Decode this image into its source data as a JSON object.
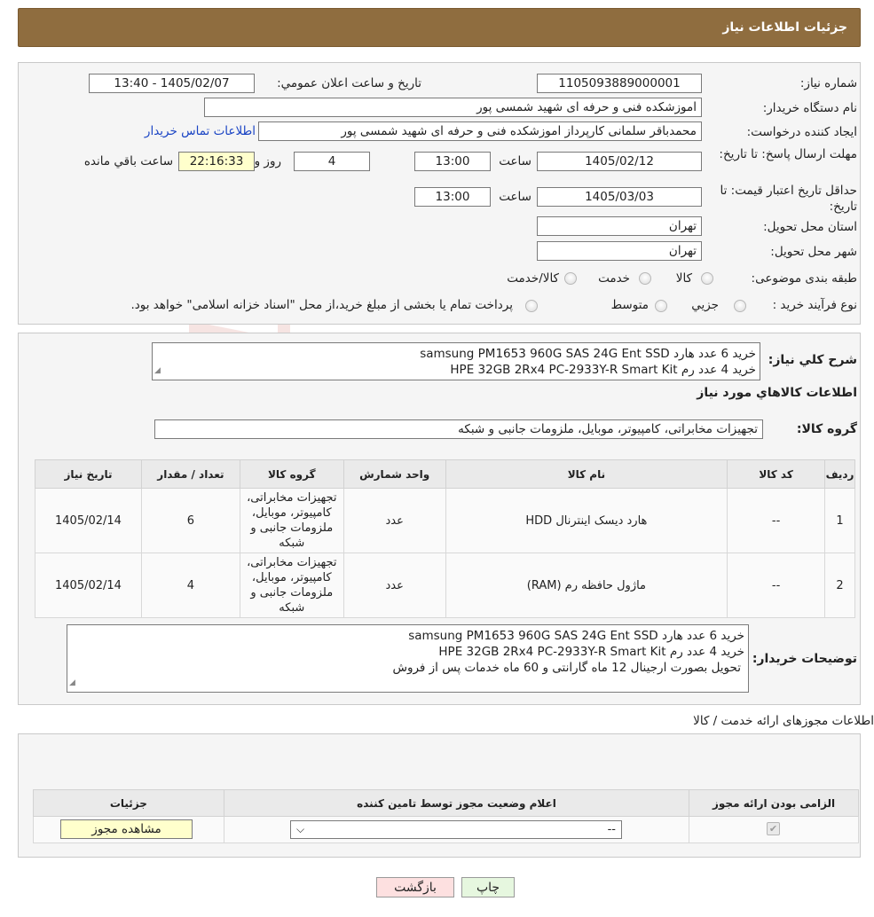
{
  "header": {
    "title": "جزئیات اطلاعات نیاز"
  },
  "fields": {
    "need_number_label": "شماره نیاز:",
    "need_number": "1105093889000001",
    "announce_label": "تاریخ و ساعت اعلان عمومي:",
    "announce_value": "1405/02/07 - 13:40",
    "buyer_org_label": "نام دستگاه خریدار:",
    "buyer_org": "اموزشکده فنی و حرفه ای شهید شمسی پور",
    "requester_label": "ایجاد کننده درخواست:",
    "requester": "محمدباقر سلمانی کارپرداز اموزشکده فنی و حرفه ای شهید شمسی پور",
    "contact_link": "اطلاعات تماس خریدار",
    "deadline_label": "مهلت ارسال پاسخ: تا تاریخ:",
    "deadline_date": "1405/02/12",
    "time_label": "ساعت",
    "deadline_time": "13:00",
    "days_value": "4",
    "days_label": "روز و",
    "remaining_time": "22:16:33",
    "remaining_label": "ساعت باقي مانده",
    "validity_label": "حداقل تاریخ اعتبار قیمت: تا تاریخ:",
    "validity_date": "1405/03/03",
    "validity_time": "13:00",
    "province_label": "استان محل تحویل:",
    "province": "تهران",
    "city_label": "شهر محل تحویل:",
    "city": "تهران",
    "category_label": "طبقه بندی موضوعی:",
    "category_options": [
      "کالا",
      "خدمت",
      "کالا/خدمت"
    ],
    "process_label": "نوع فرآیند خرید :",
    "process_options": [
      "جزیي",
      "متوسط"
    ],
    "process_note": "پرداخت تمام یا بخشی از مبلغ خرید،از محل \"اسناد خزانه اسلامی\" خواهد بود."
  },
  "description": {
    "label": "شرح کلي نیاز:",
    "lines": [
      "خرید 6 عدد هارد samsung PM1653 960G SAS 24G Ent SSD",
      "خرید 4 عدد رم HPE 32GB 2Rx4 PC-2933Y-R Smart Kit"
    ]
  },
  "goods": {
    "section_title": "اطلاعات کالاهاي مورد نیاز",
    "group_label": "گروه کالا:",
    "group_value": "تجهیزات مخابراتی، کامپیوتر، موبایل، ملزومات جانبی و شبکه",
    "columns": [
      "ردیف",
      "کد کالا",
      "نام کالا",
      "واحد شمارش",
      "گروه کالا",
      "تعداد / مقدار",
      "تاریخ نیاز"
    ],
    "rows": [
      {
        "row": "1",
        "code": "--",
        "name": "هارد دیسک اینترنال HDD",
        "unit": "عدد",
        "group": "تجهیزات مخابراتی، کامپیوتر، موبایل، ملزومات جانبی و شبکه",
        "qty": "6",
        "date": "1405/02/14"
      },
      {
        "row": "2",
        "code": "--",
        "name": "ماژول حافظه رم (RAM)",
        "unit": "عدد",
        "group": "تجهیزات مخابراتی، کامپیوتر، موبایل، ملزومات جانبی و شبکه",
        "qty": "4",
        "date": "1405/02/14"
      }
    ]
  },
  "buyer_notes": {
    "label": "توضیحات خریدار:",
    "lines": [
      "خرید 6 عدد هارد samsung PM1653 960G SAS 24G Ent SSD",
      "خرید 4 عدد رم HPE 32GB 2Rx4 PC-2933Y-R Smart Kit",
      "تحویل  بصورت ارجینال 12 ماه گارانتی و 60 ماه خدمات پس از فروش"
    ]
  },
  "permits": {
    "title": "اطلاعات مجوزهای ارائه خدمت / کالا",
    "columns": [
      "الزامی بودن ارائه مجوز",
      "اعلام وضعیت مجوز توسط تامین کننده",
      "جزئیات"
    ],
    "select_value": "--",
    "view_button": "مشاهده مجوز"
  },
  "buttons": {
    "print": "چاپ",
    "back": "بازگشت"
  },
  "watermark": {
    "text": "AriaTender.neT"
  },
  "colors": {
    "header_bg": "#8f6d3f",
    "link": "#1a44c4",
    "highlight": "#ffffcc",
    "back_button": "#fde0e0",
    "print_button": "#e6f7df"
  }
}
